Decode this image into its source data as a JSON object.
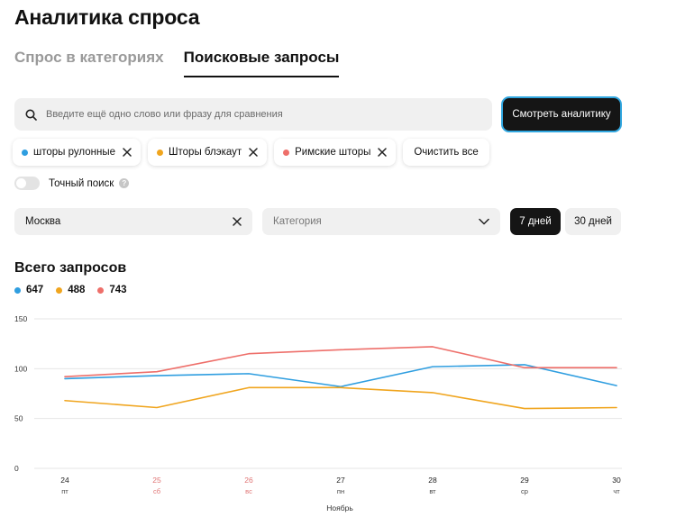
{
  "header": {
    "title": "Аналитика спроса"
  },
  "tabs": [
    {
      "label": "Спрос в категориях",
      "active": false
    },
    {
      "label": "Поисковые запросы",
      "active": true
    }
  ],
  "search": {
    "placeholder": "Введите ещё одно слово или фразу для сравнения",
    "value": ""
  },
  "analytics_button": {
    "label": "Смотреть аналитику"
  },
  "chips": [
    {
      "label": "шторы рулонные",
      "color": "#2f9ee0"
    },
    {
      "label": "Шторы блэкаут",
      "color": "#f0a51e"
    },
    {
      "label": "Римские шторы",
      "color": "#ee6f6a"
    }
  ],
  "clear_all": {
    "label": "Очистить все"
  },
  "exact_search": {
    "label": "Точный поиск",
    "enabled": false,
    "help_icon": "question-circle-icon"
  },
  "filters": {
    "city": {
      "value": "Москва"
    },
    "category": {
      "placeholder": "Категория"
    },
    "periods": [
      {
        "label": "7 дней",
        "active": true
      },
      {
        "label": "30 дней",
        "active": false
      }
    ]
  },
  "chart_title": "Всего запросов",
  "legend": [
    {
      "value": "647",
      "color": "#2f9ee0"
    },
    {
      "value": "488",
      "color": "#f0a51e"
    },
    {
      "value": "743",
      "color": "#ee6f6a"
    }
  ],
  "chart_data": {
    "type": "line",
    "title": "Всего запросов",
    "xlabel": "Ноябрь",
    "ylabel": "",
    "ylim": [
      0,
      150
    ],
    "yticks": [
      0,
      50,
      100,
      150
    ],
    "grid": true,
    "categories": [
      {
        "day": "24",
        "weekday": "пт",
        "weekend": false
      },
      {
        "day": "25",
        "weekday": "сб",
        "weekend": true
      },
      {
        "day": "26",
        "weekday": "вс",
        "weekend": true
      },
      {
        "day": "27",
        "weekday": "пн",
        "weekend": false
      },
      {
        "day": "28",
        "weekday": "вт",
        "weekend": false
      },
      {
        "day": "29",
        "weekday": "ср",
        "weekend": false
      },
      {
        "day": "30",
        "weekday": "чт",
        "weekend": false
      }
    ],
    "series": [
      {
        "color": "#2f9ee0",
        "values": [
          90,
          93,
          95,
          82,
          102,
          104,
          83
        ]
      },
      {
        "color": "#f0a51e",
        "values": [
          68,
          61,
          81,
          81,
          76,
          60,
          61
        ]
      },
      {
        "color": "#ee6f6a",
        "values": [
          92,
          97,
          115,
          119,
          122,
          101,
          101
        ]
      }
    ],
    "axis_color": "#999999",
    "weekend_color": "#e07575"
  }
}
